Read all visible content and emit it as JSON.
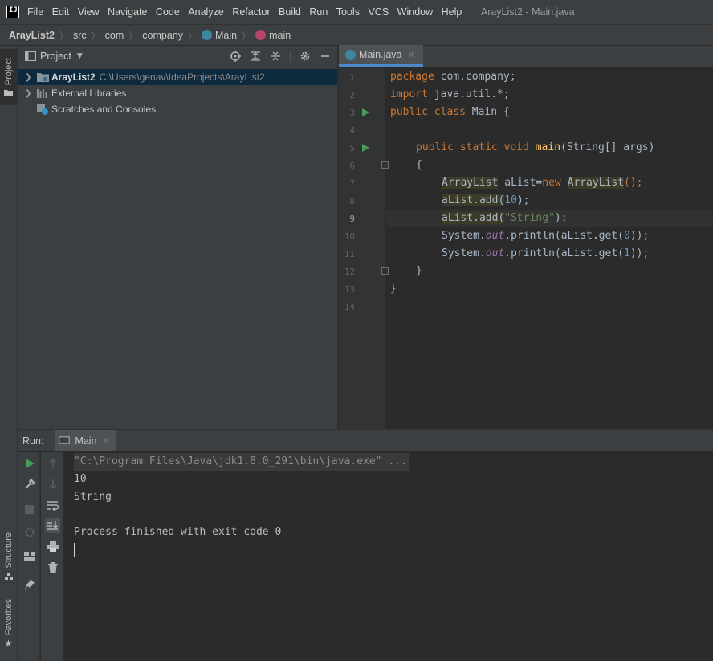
{
  "app": {
    "logo_text": "IJ",
    "window_title": "ArayList2 - Main.java"
  },
  "menu": [
    "File",
    "Edit",
    "View",
    "Navigate",
    "Code",
    "Analyze",
    "Refactor",
    "Build",
    "Run",
    "Tools",
    "VCS",
    "Window",
    "Help"
  ],
  "breadcrumb": [
    "ArayList2",
    "src",
    "com",
    "company",
    "Main",
    "main"
  ],
  "left_stripe": {
    "project_tab": "Project",
    "structure_tab": "Structure",
    "favorites_tab": "Favorites"
  },
  "project_panel": {
    "title": "Project",
    "tree": [
      {
        "label": "ArayList2",
        "path": "C:\\Users\\genav\\IdeaProjects\\ArayList2",
        "icon": "folder-icon"
      },
      {
        "label": "External Libraries",
        "path": "",
        "icon": "library-icon"
      },
      {
        "label": "Scratches and Consoles",
        "path": "",
        "icon": "scratches-icon"
      }
    ]
  },
  "editor": {
    "tab_label": "Main.java",
    "current_line": 9,
    "line_numbers": [
      "1",
      "2",
      "3",
      "4",
      "5",
      "6",
      "7",
      "8",
      "9",
      "10",
      "11",
      "12",
      "13",
      "14"
    ],
    "code": {
      "l1_kw": "package",
      "l1_rest": " com.company;",
      "l2_kw": "import",
      "l2_rest": " java.util.*;",
      "l3_kw": "public class",
      "l3_rest": " Main {",
      "l5_kw": "public static void",
      "l5_fn": "main",
      "l5_rest": "(String[] args)",
      "l6": "{",
      "l7_type": "ArrayList",
      "l7_var": " aList=",
      "l7_kw": "new",
      "l7_type2": "ArrayList",
      "l7_end": "();",
      "l8_call": "aList.add(",
      "l8_num": "10",
      "l8_end": ");",
      "l9_call": "aList.add(",
      "l9_str": "\"String\"",
      "l9_end": ");",
      "l10_pre": "System.",
      "l10_field": "out",
      "l10_call": ".println(aList.get(",
      "l10_num": "0",
      "l10_end": "));",
      "l11_pre": "System.",
      "l11_field": "out",
      "l11_call": ".println(aList.get(",
      "l11_num": "1",
      "l11_end": "));",
      "l12": "}",
      "l13": "}"
    }
  },
  "run_panel": {
    "label": "Run:",
    "tab_label": "Main",
    "console": [
      "\"C:\\Program Files\\Java\\jdk1.8.0_291\\bin\\java.exe\" ...",
      "10",
      "String",
      "",
      "Process finished with exit code 0"
    ]
  }
}
